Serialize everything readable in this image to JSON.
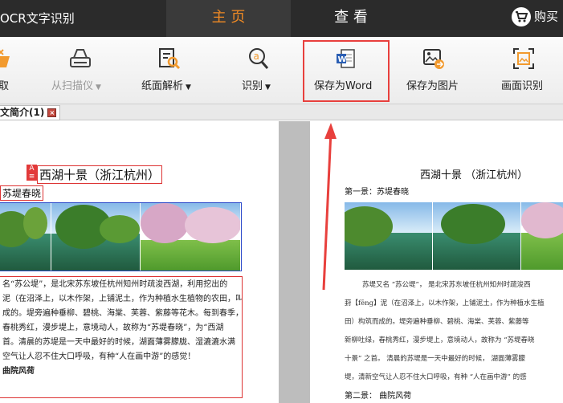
{
  "app": {
    "title": "OCR文字识别"
  },
  "nav": {
    "home": "主 页",
    "view": "查 看",
    "buy": "购买"
  },
  "toolbar": {
    "items": [
      {
        "label": "取",
        "icon": "open-icon",
        "dropdown": false,
        "disabled": false
      },
      {
        "label": "从扫描仪",
        "icon": "scanner-icon",
        "dropdown": true,
        "disabled": true
      },
      {
        "label": "纸面解析",
        "icon": "parse-document-icon",
        "dropdown": true,
        "disabled": false
      },
      {
        "label": "识别",
        "icon": "recognize-icon",
        "dropdown": true,
        "disabled": false
      },
      {
        "label": "保存为Word",
        "icon": "word-icon",
        "dropdown": false,
        "disabled": false
      },
      {
        "label": "保存为图片",
        "icon": "save-image-icon",
        "dropdown": false,
        "disabled": false
      },
      {
        "label": "画面识别",
        "icon": "screen-capture-icon",
        "dropdown": false,
        "disabled": false
      }
    ]
  },
  "doc_tab": {
    "label": "文简介(1)"
  },
  "left_page": {
    "mark": "A 三",
    "title": "西湖十景（浙江杭州）",
    "subtitle": "苏堤春晓",
    "lines": [
      "名“苏公堤”，是北宋苏东坡任杭州知州时疏浚西湖，利用挖出的",
      "泥（在沼泽上，以木作架，上铺泥土，作为种植水生植物的农田，叫葑",
      "成的。堤旁遍种垂柳、碧桃、海棠、芙蓉、紫藤等花木。每到春季，",
      "春桃秀红，漫步堤上，意境动人，故称为“苏堤春晓”，为“西湖",
      "首。清晨的苏堤是一天中最好的时候，湖面薄雾朦胧、湿漉漉水满",
      "空气让人忍不住大口呼吸，有种“人在画中游”的感觉！"
    ],
    "section2": "曲院风荷"
  },
  "right_page": {
    "title": "西湖十景 （浙江杭州）",
    "subtitle": "第一景：苏堤春晓",
    "lines": [
      "苏堤又名 “苏公堤”，  是北宋苏东坡任杭州知州时疏浚西",
      "葑【fēng】泥（在沼泽上，以木作架，上铺泥土，作为种植水生植",
      "田）构筑而成的。堤旁遍种垂柳、碧桃、海棠、芙蓉、紫藤等",
      "新柳吐绿，春桃秀红，漫步堤上，意境动人，故称为 “苏堤春晓",
      "十景” 之首。  清晨的苏堤是一天中最好的时候，  湖面薄雾朦",
      "堤，清新空气让人忍不住大口呼吸，有种 “人在画中游” 的感"
    ],
    "section2": "第二景：   曲院风荷"
  },
  "colors": {
    "accent": "#f08a24",
    "highlight": "#e8403d",
    "topbar": "#2b2b2b"
  }
}
